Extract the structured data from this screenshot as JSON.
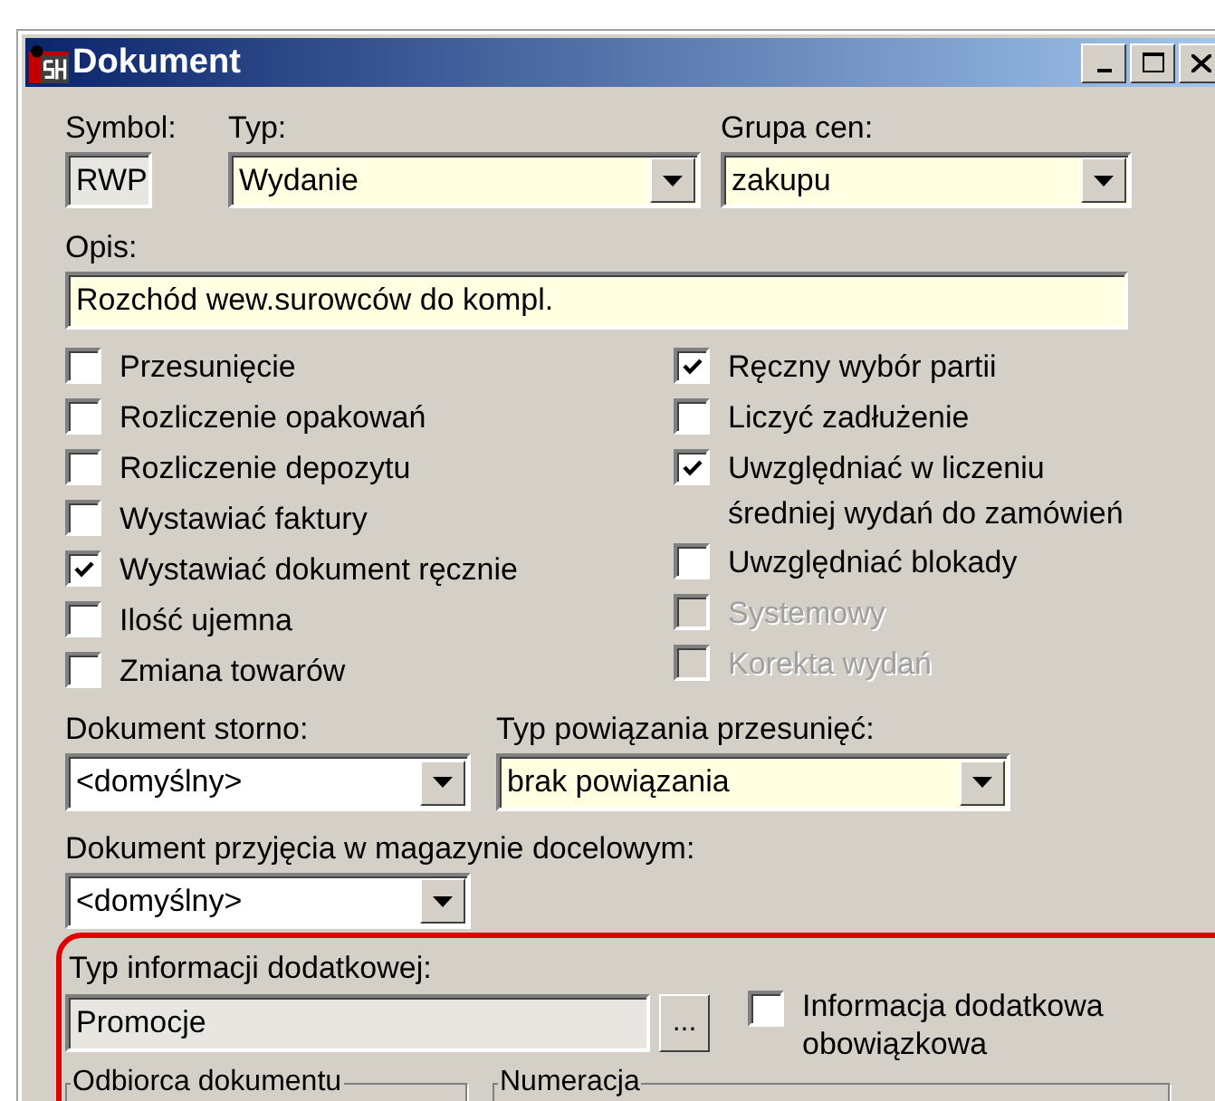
{
  "window": {
    "title": "Dokument"
  },
  "symbol": {
    "label": "Symbol:",
    "value": "RWP"
  },
  "typ": {
    "label": "Typ:",
    "value": "Wydanie",
    "highlighted": true
  },
  "grupa_cen": {
    "label": "Grupa cen:",
    "value": "zakupu",
    "highlighted": true
  },
  "opis": {
    "label": "Opis:",
    "value": "Rozchód wew.surowców do kompl.",
    "highlighted": true
  },
  "options_left": [
    {
      "label": "Przesunięcie",
      "checked": false,
      "disabled": false
    },
    {
      "label": "Rozliczenie opakowań",
      "checked": false,
      "disabled": false
    },
    {
      "label": "Rozliczenie depozytu",
      "checked": false,
      "disabled": false
    },
    {
      "label": "Wystawiać faktury",
      "checked": false,
      "disabled": false
    },
    {
      "label": "Wystawiać dokument ręcznie",
      "checked": true,
      "disabled": false
    },
    {
      "label": "Ilość ujemna",
      "checked": false,
      "disabled": false
    },
    {
      "label": "Zmiana towarów",
      "checked": false,
      "disabled": false
    }
  ],
  "options_right": [
    {
      "label": "Ręczny wybór partii",
      "checked": true,
      "disabled": false
    },
    {
      "label": "Liczyć zadłużenie",
      "checked": false,
      "disabled": false
    },
    {
      "label": "Uwzględniać w liczeniu\nśredniej wydań do zamówień",
      "checked": true,
      "disabled": false
    },
    {
      "label": "Uwzględniać blokady",
      "checked": false,
      "disabled": false
    },
    {
      "label": "Systemowy",
      "checked": false,
      "disabled": true
    },
    {
      "label": "Korekta wydań",
      "checked": false,
      "disabled": true
    }
  ],
  "dokument_storno": {
    "label": "Dokument storno:",
    "value": "<domyślny>",
    "highlighted": false
  },
  "typ_powiazania": {
    "label": "Typ powiązania przesunięć:",
    "value": "brak powiązania",
    "highlighted": true
  },
  "dokument_przyjecia": {
    "label": "Dokument przyjęcia w magazynie docelowym:",
    "value": "<domyślny>",
    "highlighted": false
  },
  "info": {
    "label": "Typ informacji dodatkowej:",
    "value": "Promocje",
    "button": "...",
    "required_label": "Informacja dodatkowa\nobowiązkowa",
    "required_checked": false
  },
  "groups": [
    {
      "title": "Odbiorca dokumentu"
    },
    {
      "title": "Numeracja"
    }
  ]
}
